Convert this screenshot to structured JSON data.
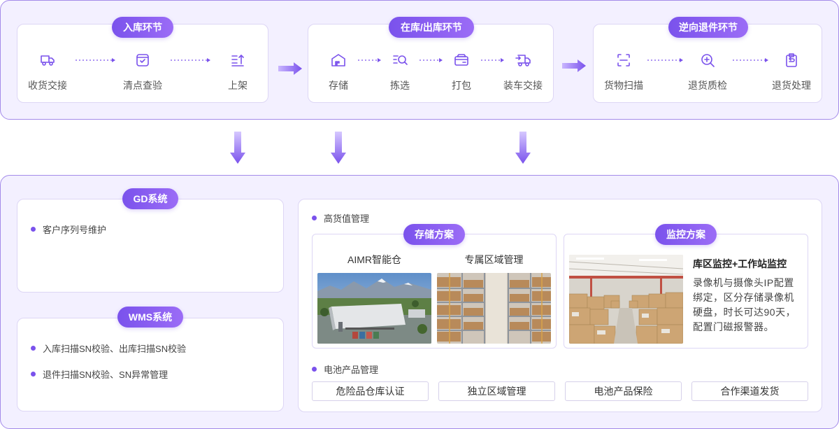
{
  "flow": {
    "inbound": {
      "title": "入库环节",
      "steps": [
        {
          "label": "收货交接",
          "icon": "truck-icon"
        },
        {
          "label": "清点查验",
          "icon": "check-box-icon"
        },
        {
          "label": "上架",
          "icon": "shelve-list-icon"
        }
      ]
    },
    "storage": {
      "title": "在库/出库环节",
      "steps": [
        {
          "label": "存储",
          "icon": "warehouse-icon"
        },
        {
          "label": "拣选",
          "icon": "pick-search-icon"
        },
        {
          "label": "打包",
          "icon": "package-icon"
        },
        {
          "label": "装车交接",
          "icon": "loading-truck-icon"
        }
      ]
    },
    "returns": {
      "title": "逆向退件环节",
      "steps": [
        {
          "label": "货物扫描",
          "icon": "scan-icon"
        },
        {
          "label": "退货质检",
          "icon": "inspect-icon"
        },
        {
          "label": "退货处理",
          "icon": "return-process-icon"
        }
      ]
    }
  },
  "systems": {
    "gd": {
      "title": "GD系统",
      "items": [
        "客户序列号维护"
      ]
    },
    "wms": {
      "title": "WMS系统",
      "items": [
        "入库扫描SN校验、出库扫描SN校验",
        "退件扫描SN校验、SN异常管理"
      ]
    }
  },
  "management": {
    "high_value": {
      "title": "高货值管理",
      "storage_plan": {
        "title": "存储方案",
        "photos": [
          {
            "caption": "AIMR智能仓"
          },
          {
            "caption": "专属区域管理"
          }
        ]
      },
      "monitor_plan": {
        "title": "监控方案",
        "heading": "库区监控+工作站监控",
        "description": "录像机与摄像头IP配置绑定，区分存储录像机硬盘，时长可达90天，配置门磁报警器。"
      }
    },
    "battery": {
      "title": "电池产品管理",
      "tags": [
        "危险品仓库认证",
        "独立区域管理",
        "电池产品保险",
        "合作渠道发货"
      ]
    }
  },
  "colors": {
    "accent": "#7a52ec",
    "panel_bg": "#f3f0ff",
    "border": "#a48bea"
  }
}
